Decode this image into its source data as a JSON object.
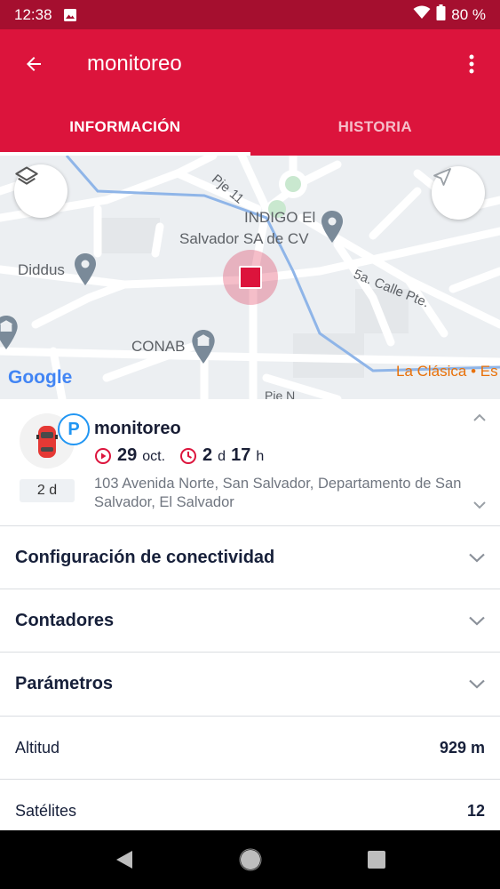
{
  "status_bar": {
    "time": "12:38",
    "battery": "80 %"
  },
  "app_bar": {
    "title": "monitoreo"
  },
  "tabs": [
    {
      "label": "INFORMACIÓN",
      "active": true
    },
    {
      "label": "HISTORIA",
      "active": false
    }
  ],
  "map": {
    "labels": {
      "street_pje": "Pje 11",
      "indigo_line1": "INDIGO El",
      "indigo_line2": "Salvador SA de CV",
      "diddus": "Diddus",
      "calle": "5a. Calle Pte.",
      "conab": "CONAB",
      "clasica": "La Clásica • Es",
      "pie": "Pie N",
      "google": "Google"
    }
  },
  "unit": {
    "name": "monitoreo",
    "parking_badge": "P",
    "age_chip": "2 d",
    "start_day": "29",
    "start_month": "oct.",
    "duration_d_value": "2",
    "duration_d_unit": "d",
    "duration_h_value": "17",
    "duration_h_unit": "h",
    "address": "103 Avenida Norte, San Salvador, Departamento de San Salvador, El Salvador"
  },
  "sections": [
    {
      "title": "Configuración de conectividad"
    },
    {
      "title": "Contadores"
    },
    {
      "title": "Parámetros"
    }
  ],
  "rows": [
    {
      "label": "Altitud",
      "value": "929 m"
    },
    {
      "label": "Satélites",
      "value": "12"
    }
  ],
  "colors": {
    "primary": "#dc143c",
    "status_bar": "#a50f2f",
    "marker": "#dc143c",
    "route": "#8fb5e8"
  }
}
